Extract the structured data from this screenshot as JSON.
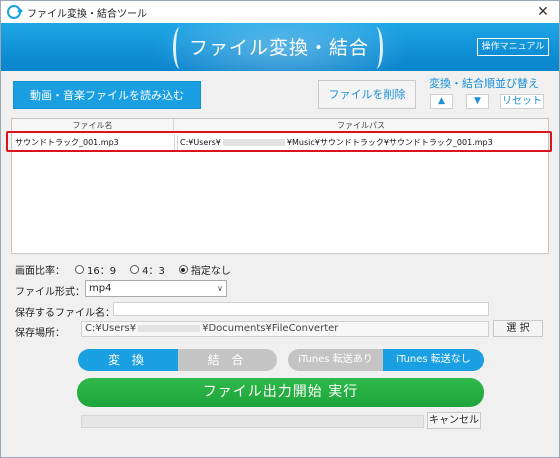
{
  "window": {
    "title": "ファイル変換・結合ツール",
    "close_glyph": "✕"
  },
  "banner": {
    "title": "ファイル変換・結合",
    "manual_label": "操作マニュアル"
  },
  "toolbar": {
    "load_label": "動画・音楽ファイルを読み込む",
    "delete_label": "ファイルを削除",
    "order_label": "変換・結合順並び替え",
    "up_glyph": "▲",
    "down_glyph": "▼",
    "reset_label": "リセット"
  },
  "table": {
    "columns": [
      "ファイル名",
      "ファイルパス"
    ],
    "rows": [
      {
        "name": "サウンドトラック_001.mp3",
        "path_prefix": "C:¥Users¥",
        "path_suffix": "¥Music¥サウンドトラック¥サウンドトラック_001.mp3"
      }
    ]
  },
  "settings": {
    "ratio_label": "画面比率：",
    "ratio_options": [
      "16：9",
      "4：3",
      "指定なし"
    ],
    "ratio_selected": "指定なし",
    "format_label": "ファイル形式：",
    "format_value": "mp4",
    "savename_label": "保存するファイル名：",
    "savename_value": "",
    "saveloc_label": "保存場所：",
    "saveloc_prefix": "C:¥Users¥",
    "saveloc_suffix": "¥Documents¥FileConverter",
    "browse_label": "選 択"
  },
  "actions": {
    "convert_label": "変 換",
    "join_label": "結 合",
    "mode_selected": "変 換",
    "itunes_on_label": "iTunes 転送あり",
    "itunes_off_label": "iTunes 転送なし",
    "itunes_selected": "iTunes 転送なし",
    "run_label": "ファイル出力開始 実行",
    "cancel_label": "キャンセル",
    "progress": 0
  },
  "colors": {
    "accent": "#1aa0e2",
    "run_green": "#1ea43a",
    "highlight_red": "#d9141c",
    "inactive_gray": "#c4c4c4"
  }
}
